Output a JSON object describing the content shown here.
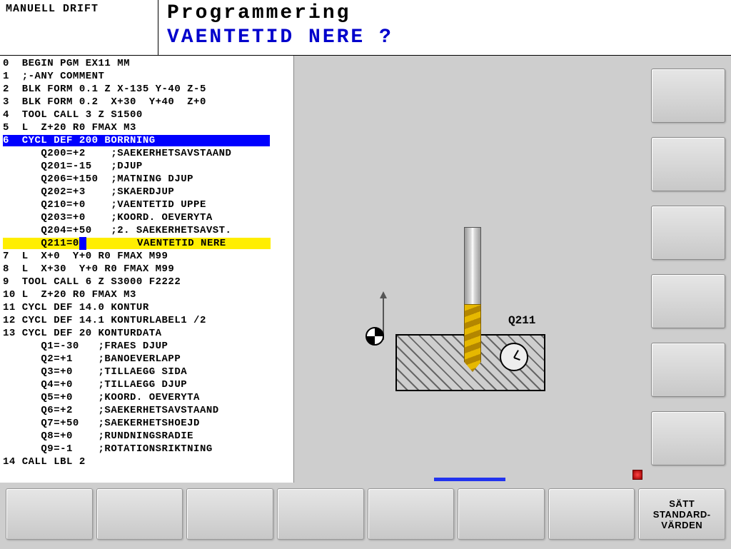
{
  "header": {
    "mode": "MANUELL DRIFT",
    "title": "Programmering",
    "prompt": "VAENTETID NERE ?"
  },
  "program": [
    {
      "n": "0",
      "t": "BEGIN PGM EX11 MM"
    },
    {
      "n": "1",
      "t": ";-ANY COMMENT"
    },
    {
      "n": "2",
      "t": "BLK FORM 0.1 Z X-135 Y-40 Z-5"
    },
    {
      "n": "3",
      "t": "BLK FORM 0.2  X+30  Y+40  Z+0"
    },
    {
      "n": "4",
      "t": "TOOL CALL 3 Z S1500"
    },
    {
      "n": "5",
      "t": "L  Z+20 R0 FMAX M3"
    },
    {
      "n": "6",
      "t": "CYCL DEF 200 BORRNING",
      "hl": "blue"
    },
    {
      "n": "",
      "t": "   Q200=+2    ;SAEKERHETSAVSTAAND"
    },
    {
      "n": "",
      "t": "   Q201=-15   ;DJUP"
    },
    {
      "n": "",
      "t": "   Q206=+150  ;MATNING DJUP"
    },
    {
      "n": "",
      "t": "   Q202=+3    ;SKAERDJUP"
    },
    {
      "n": "",
      "t": "   Q210=+0    ;VAENTETID UPPE"
    },
    {
      "n": "",
      "t": "   Q203=+0    ;KOORD. OEVERYTA"
    },
    {
      "n": "",
      "t": "   Q204=+50   ;2. SAEKERHETSAVST."
    },
    {
      "n": "",
      "t": "   Q211=0",
      "t2": "        VAENTETID NERE",
      "hl": "yellow"
    },
    {
      "n": "7",
      "t": "L  X+0  Y+0 R0 FMAX M99"
    },
    {
      "n": "8",
      "t": "L  X+30  Y+0 R0 FMAX M99"
    },
    {
      "n": "9",
      "t": "TOOL CALL 6 Z S3000 F2222"
    },
    {
      "n": "10",
      "t": "L  Z+20 R0 FMAX M3"
    },
    {
      "n": "11",
      "t": "CYCL DEF 14.0 KONTUR"
    },
    {
      "n": "12",
      "t": "CYCL DEF 14.1 KONTURLABEL1 /2"
    },
    {
      "n": "13",
      "t": "CYCL DEF 20 KONTURDATA"
    },
    {
      "n": "",
      "t": "   Q1=-30   ;FRAES DJUP"
    },
    {
      "n": "",
      "t": "   Q2=+1    ;BANOEVERLAPP"
    },
    {
      "n": "",
      "t": "   Q3=+0    ;TILLAEGG SIDA"
    },
    {
      "n": "",
      "t": "   Q4=+0    ;TILLAEGG DJUP"
    },
    {
      "n": "",
      "t": "   Q5=+0    ;KOORD. OEVERYTA"
    },
    {
      "n": "",
      "t": "   Q6=+2    ;SAEKERHETSAVSTAAND"
    },
    {
      "n": "",
      "t": "   Q7=+50   ;SAEKERHETSHOEJD"
    },
    {
      "n": "",
      "t": "   Q8=+0    ;RUNDNINGSRADIE"
    },
    {
      "n": "",
      "t": "   Q9=-1    ;ROTATIONSRIKTNING"
    },
    {
      "n": "14",
      "t": "CALL LBL 2"
    }
  ],
  "graphic": {
    "param_label": "Q211"
  },
  "softkeys": [
    "",
    "",
    "",
    "",
    "",
    "",
    "",
    "SÄTT\nSTANDARD-\nVÄRDEN"
  ]
}
